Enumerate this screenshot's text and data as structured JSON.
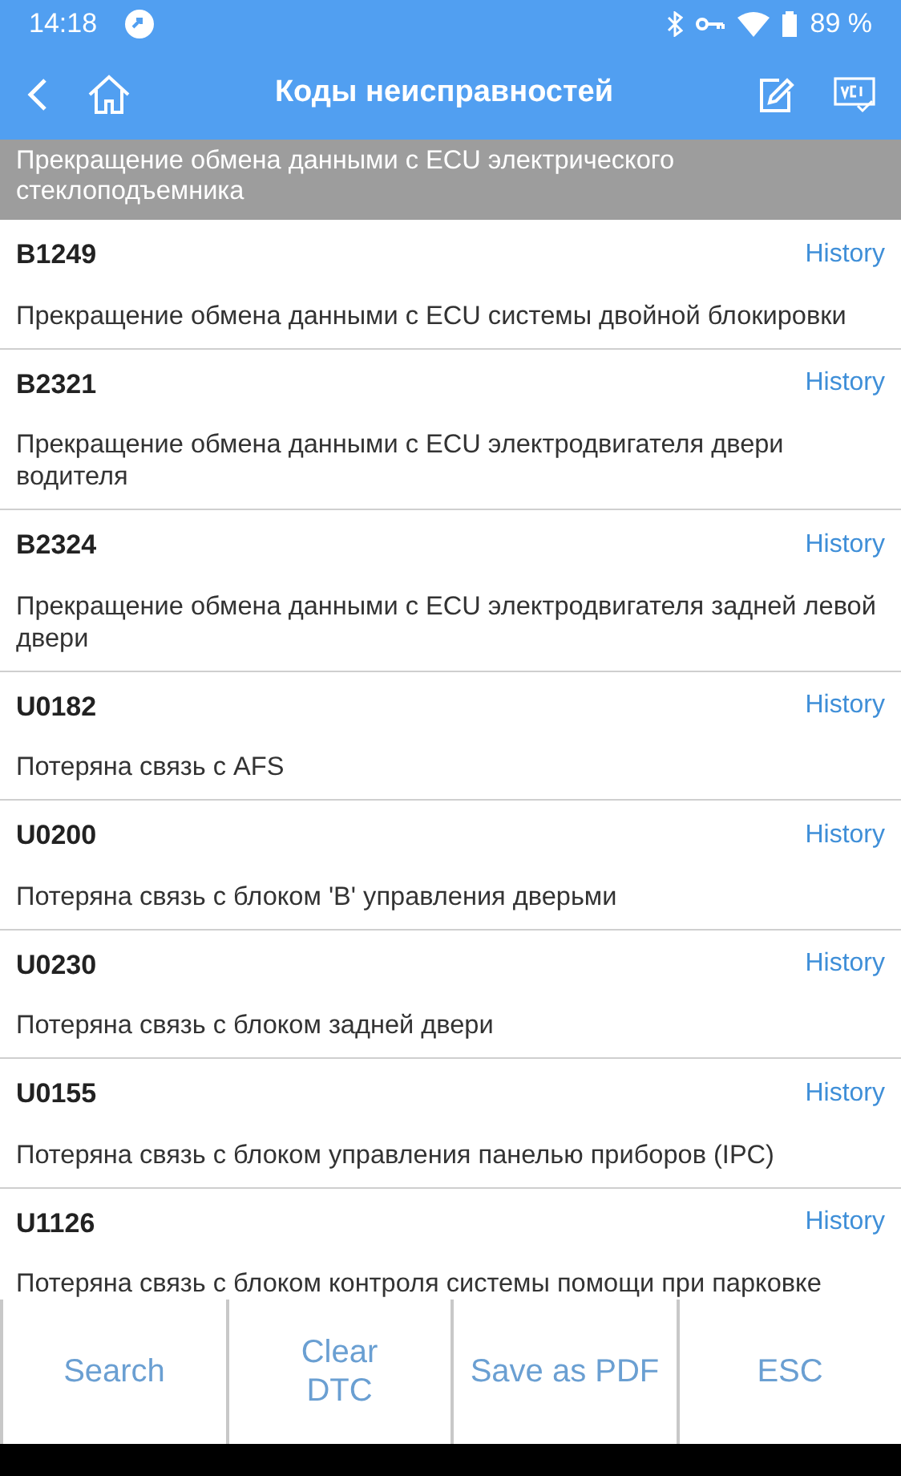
{
  "status_bar": {
    "time": "14:18",
    "battery": "89 %"
  },
  "app_bar": {
    "title": "Коды неисправностей"
  },
  "header": "Прекращение обмена данными с ECU электрического стеклоподъемника",
  "codes": [
    {
      "code": "B1249",
      "link": "History",
      "description": "Прекращение обмена данными с ECU системы двойной блокировки"
    },
    {
      "code": "B2321",
      "link": "History",
      "description": "Прекращение обмена данными с ECU электродвигателя двери водителя"
    },
    {
      "code": "B2324",
      "link": "History",
      "description": "Прекращение обмена данными с ECU электродвигателя задней левой двери"
    },
    {
      "code": "U0182",
      "link": "History",
      "description": "Потеряна связь с AFS"
    },
    {
      "code": "U0200",
      "link": "History",
      "description": "Потеряна связь с блоком 'B' управления дверьми"
    },
    {
      "code": "U0230",
      "link": "History",
      "description": "Потеряна связь с блоком задней двери"
    },
    {
      "code": "U0155",
      "link": "History",
      "description": "Потеряна связь с блоком управления панелью приборов (IPC)"
    },
    {
      "code": "U1126",
      "link": "History",
      "description": "Потеряна связь с блоком контроля системы помощи при парковке"
    }
  ],
  "buttons": [
    "Search",
    "Clear\nDTC",
    "Save as PDF",
    "ESC"
  ]
}
